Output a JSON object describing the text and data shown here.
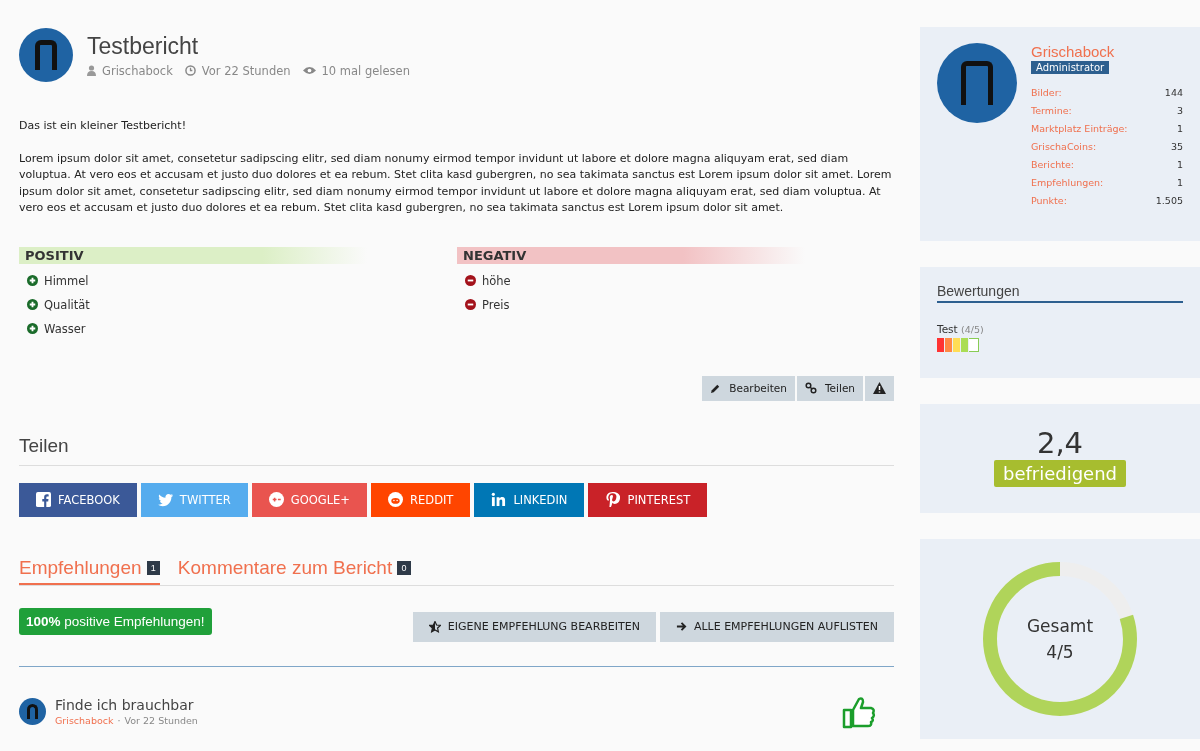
{
  "article": {
    "title": "Testbericht",
    "author": "Grischabock",
    "time": "Vor 22 Stunden",
    "views": "10 mal gelesen"
  },
  "body": [
    "Das ist ein kleiner Testbericht!",
    "Lorem ipsum dolor sit amet, consetetur sadipscing elitr, sed diam nonumy eirmod tempor invidunt ut labore et dolore magna aliquyam erat, sed diam voluptua. At vero eos et accusam et justo duo dolores et ea rebum. Stet clita kasd gubergren, no sea takimata sanctus est Lorem ipsum dolor sit amet. Lorem ipsum dolor sit amet, consetetur sadipscing elitr, sed diam nonumy eirmod tempor invidunt ut labore et dolore magna aliquyam erat, sed diam voluptua. At vero eos et accusam et justo duo dolores et ea rebum. Stet clita kasd gubergren, no sea takimata sanctus est Lorem ipsum dolor sit amet."
  ],
  "proscons": [
    {
      "kind": "positive",
      "heading": "POSITIV",
      "items": [
        "Himmel",
        "Qualität",
        "Wasser"
      ]
    },
    {
      "kind": "negative",
      "heading": "NEGATIV",
      "items": [
        "höhe",
        "Preis"
      ]
    }
  ],
  "actions": [
    {
      "kind": "edit",
      "label": "Bearbeiten"
    },
    {
      "kind": "link",
      "label": "Teilen"
    },
    {
      "kind": "report"
    }
  ],
  "share": {
    "heading": "Teilen",
    "buttons": [
      {
        "kind": "facebook",
        "label": "FACEBOOK",
        "color": "#3b5998"
      },
      {
        "kind": "twitter",
        "label": "TWITTER",
        "color": "#55acee"
      },
      {
        "kind": "google",
        "label": "GOOGLE+",
        "color": "#e9544f"
      },
      {
        "kind": "reddit",
        "label": "REDDIT",
        "color": "#ff4500"
      },
      {
        "kind": "linkedin",
        "label": "LINKEDIN",
        "color": "#0077b5"
      },
      {
        "kind": "pinterest",
        "label": "PINTEREST",
        "color": "#c92228"
      }
    ]
  },
  "tabs": [
    {
      "label": "Empfehlungen",
      "count": "1",
      "selected": true
    },
    {
      "label": "Kommentare zum Bericht",
      "count": "0",
      "selected": false
    }
  ],
  "recommend": {
    "badge_strong": "100%",
    "badge_text": "positive Empfehlungen!",
    "buttons": [
      {
        "kind": "star",
        "label": "EIGENE EMPFEHLUNG BEARBEITEN"
      },
      {
        "kind": "arrow",
        "label": "ALLE EMPFEHLUNGEN AUFLISTEN"
      }
    ]
  },
  "comments": [
    {
      "title": "Finde ich brauchbar",
      "author": "Grischabock",
      "separator": "·",
      "time": "Vor 22 Stunden"
    }
  ],
  "profile": {
    "name": "Grischabock",
    "role": "Administrator",
    "stats": [
      {
        "label": "Bilder:",
        "value": "144"
      },
      {
        "label": "Termine:",
        "value": "3"
      },
      {
        "label": "Marktplatz Einträge:",
        "value": "1"
      },
      {
        "label": "GrischaCoins:",
        "value": "35"
      },
      {
        "label": "Berichte:",
        "value": "1"
      },
      {
        "label": "Empfehlungen:",
        "value": "1"
      },
      {
        "label": "Punkte:",
        "value": "1.505"
      }
    ]
  },
  "ratings": {
    "heading": "Bewertungen",
    "items": [
      {
        "label": "Test",
        "score": "(4/5)",
        "level": 0.8
      }
    ]
  },
  "grade": {
    "value": "2,4",
    "label": "befriedigend"
  },
  "overall": {
    "label": "Gesamt",
    "score": "4/5",
    "level": 0.8
  }
}
